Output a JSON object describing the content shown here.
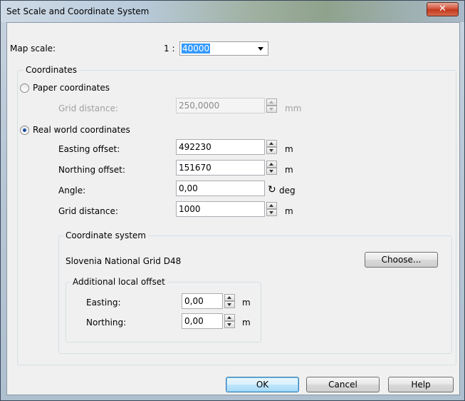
{
  "window": {
    "title": "Set Scale and Coordinate System",
    "close_glyph": "✕"
  },
  "map_scale": {
    "label": "Map scale:",
    "prefix": "1 :",
    "value": "40000"
  },
  "coordinates": {
    "group_title": "Coordinates",
    "paper": {
      "label": "Paper coordinates",
      "selected": false,
      "grid_distance_label": "Grid distance:",
      "grid_distance_value": "250,0000",
      "grid_distance_unit": "mm"
    },
    "real_world": {
      "label": "Real world coordinates",
      "selected": true,
      "easting_label": "Easting offset:",
      "easting_value": "492230",
      "easting_unit": "m",
      "northing_label": "Northing offset:",
      "northing_value": "151670",
      "northing_unit": "m",
      "angle_label": "Angle:",
      "angle_value": "0,00",
      "angle_unit": "deg",
      "grid_distance_label": "Grid distance:",
      "grid_distance_value": "1000",
      "grid_distance_unit": "m"
    },
    "coordinate_system": {
      "group_title": "Coordinate system",
      "name": "Slovenia National Grid  D48",
      "choose_label": "Choose...",
      "local_offset": {
        "group_title": "Additional local offset",
        "easting_label": "Easting:",
        "easting_value": "0,00",
        "easting_unit": "m",
        "northing_label": "Northing:",
        "northing_value": "0,00",
        "northing_unit": "m"
      }
    }
  },
  "buttons": {
    "ok": "OK",
    "cancel": "Cancel",
    "help": "Help"
  },
  "icons": {
    "rotate": "↻"
  }
}
